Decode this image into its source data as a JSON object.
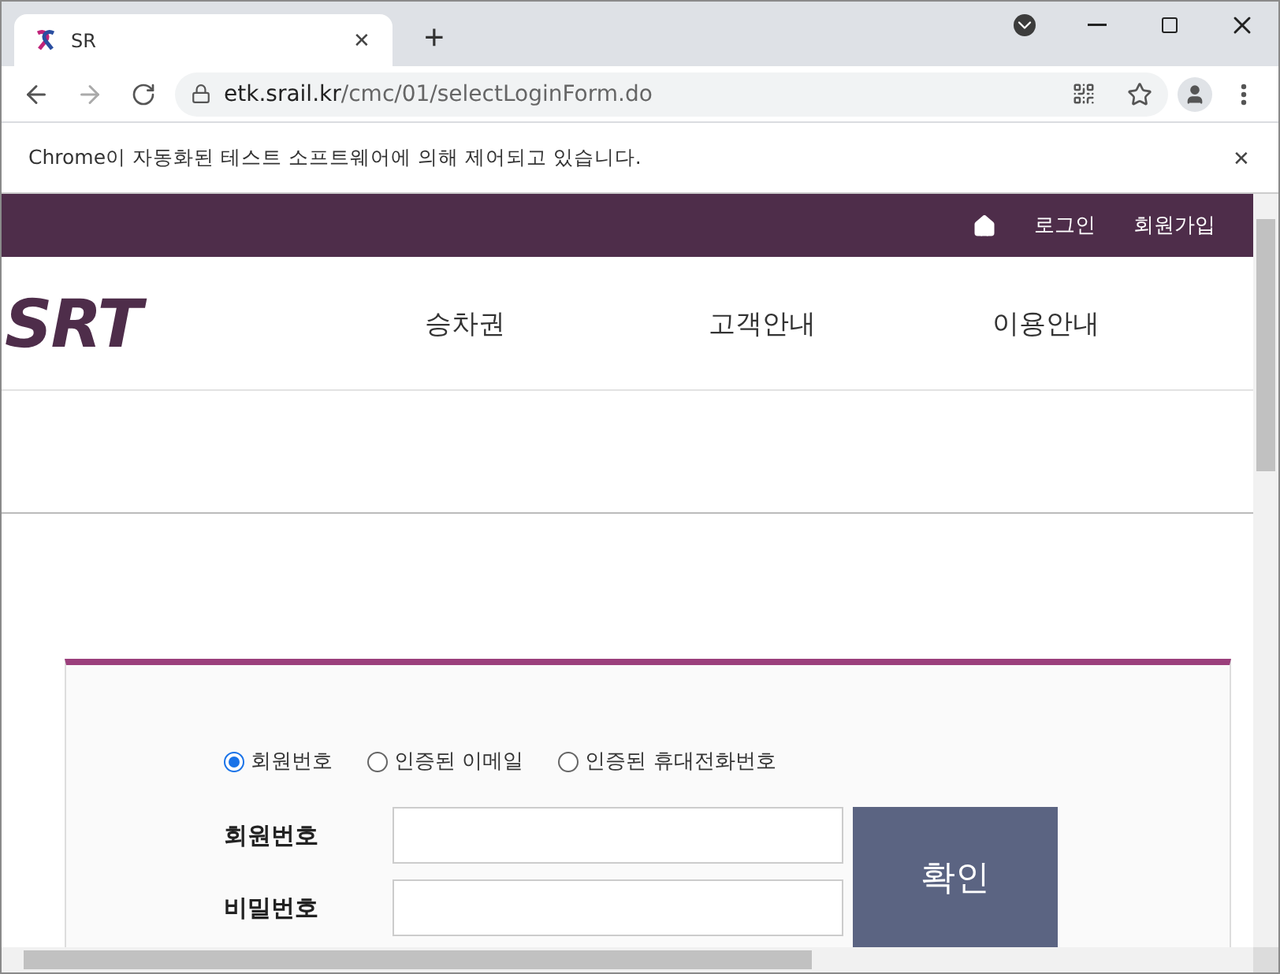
{
  "browser": {
    "tab": {
      "title": "SR",
      "close": "✕"
    },
    "new_tab": "+",
    "address": {
      "host": "etk.srail.kr",
      "path": "/cmc/01/selectLoginForm.do"
    },
    "infobar": {
      "message": "Chrome이 자동화된 테스트 소프트웨어에 의해 제어되고 있습니다.",
      "close": "✕"
    }
  },
  "page": {
    "utility_links": [
      "로그인",
      "회원가입"
    ],
    "logo": "SRT",
    "nav": [
      "승차권",
      "고객안내",
      "이용안내"
    ],
    "login": {
      "methods": [
        {
          "label": "회원번호",
          "selected": true
        },
        {
          "label": "인증된 이메일",
          "selected": false
        },
        {
          "label": "인증된 휴대전화번호",
          "selected": false
        }
      ],
      "fields": [
        {
          "label": "회원번호"
        },
        {
          "label": "비밀번호"
        }
      ],
      "submit": "확인"
    }
  }
}
